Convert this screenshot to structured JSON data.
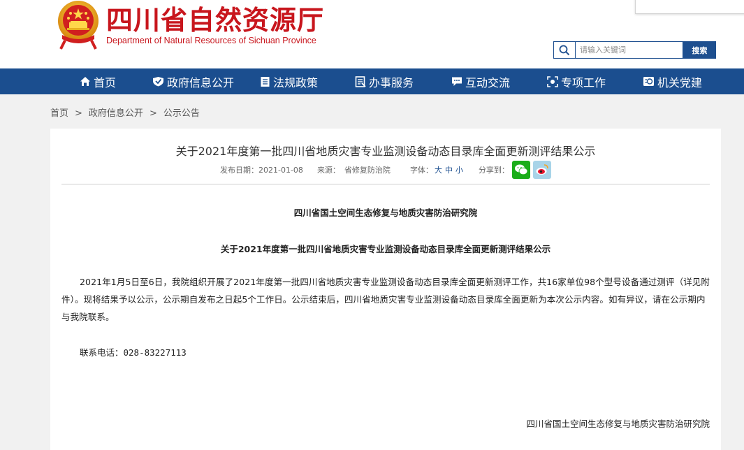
{
  "header": {
    "title": "四川省自然资源厅",
    "subtitle": "Department of Natural Resources of Sichuan Province",
    "search": {
      "placeholder": "请输入关键词",
      "button_label": "搜索"
    }
  },
  "nav": {
    "items": [
      {
        "label": "首页",
        "icon": "home-icon"
      },
      {
        "label": "政府信息公开",
        "icon": "shield-icon"
      },
      {
        "label": "法规政策",
        "icon": "book-icon"
      },
      {
        "label": "办事服务",
        "icon": "document-icon"
      },
      {
        "label": "互动交流",
        "icon": "chat-icon"
      },
      {
        "label": "专项工作",
        "icon": "target-icon"
      },
      {
        "label": "机关党建",
        "icon": "emblem-icon"
      }
    ]
  },
  "breadcrumb": {
    "items": [
      "首页",
      "公示公告"
    ],
    "middle": "政府信息公开",
    "separator": ">"
  },
  "article": {
    "title": "关于2021年度第一批四川省地质灾害专业监测设备动态目录库全面更新测评结果公示",
    "meta": {
      "date_label": "发布日期：",
      "date": "2021-01-08",
      "source_label": "来源：",
      "source": "省修复防治院",
      "font_label": "字体：",
      "font_sizes": [
        "大",
        "中",
        "小"
      ],
      "share_label": "分享到："
    },
    "org_heading": "四川省国土空间生态修复与地质灾害防治研究院",
    "doc_heading": "关于2021年度第一批四川省地质灾害专业监测设备动态目录库全面更新测评结果公示",
    "body": "2021年1月5日至6日，我院组织开展了2021年度第一批四川省地质灾害专业监测设备动态目录库全面更新测评工作，共16家单位98个型号设备通过测评（详见附件）。现将结果予以公示，公示期自发布之日起5个工作日。公示结束后，四川省地质灾害专业监测设备动态目录库全面更新为本次公示内容。如有异议，请在公示期内与我院联系。",
    "contact": "联系电话：028-83227113",
    "signature": "四川省国土空间生态修复与地质灾害防治研究院"
  },
  "colors": {
    "brand_red": "#c8161d",
    "nav_blue": "#1b4e8f",
    "wechat_green": "#1aad19",
    "weibo_blue": "#a8d4e8"
  }
}
